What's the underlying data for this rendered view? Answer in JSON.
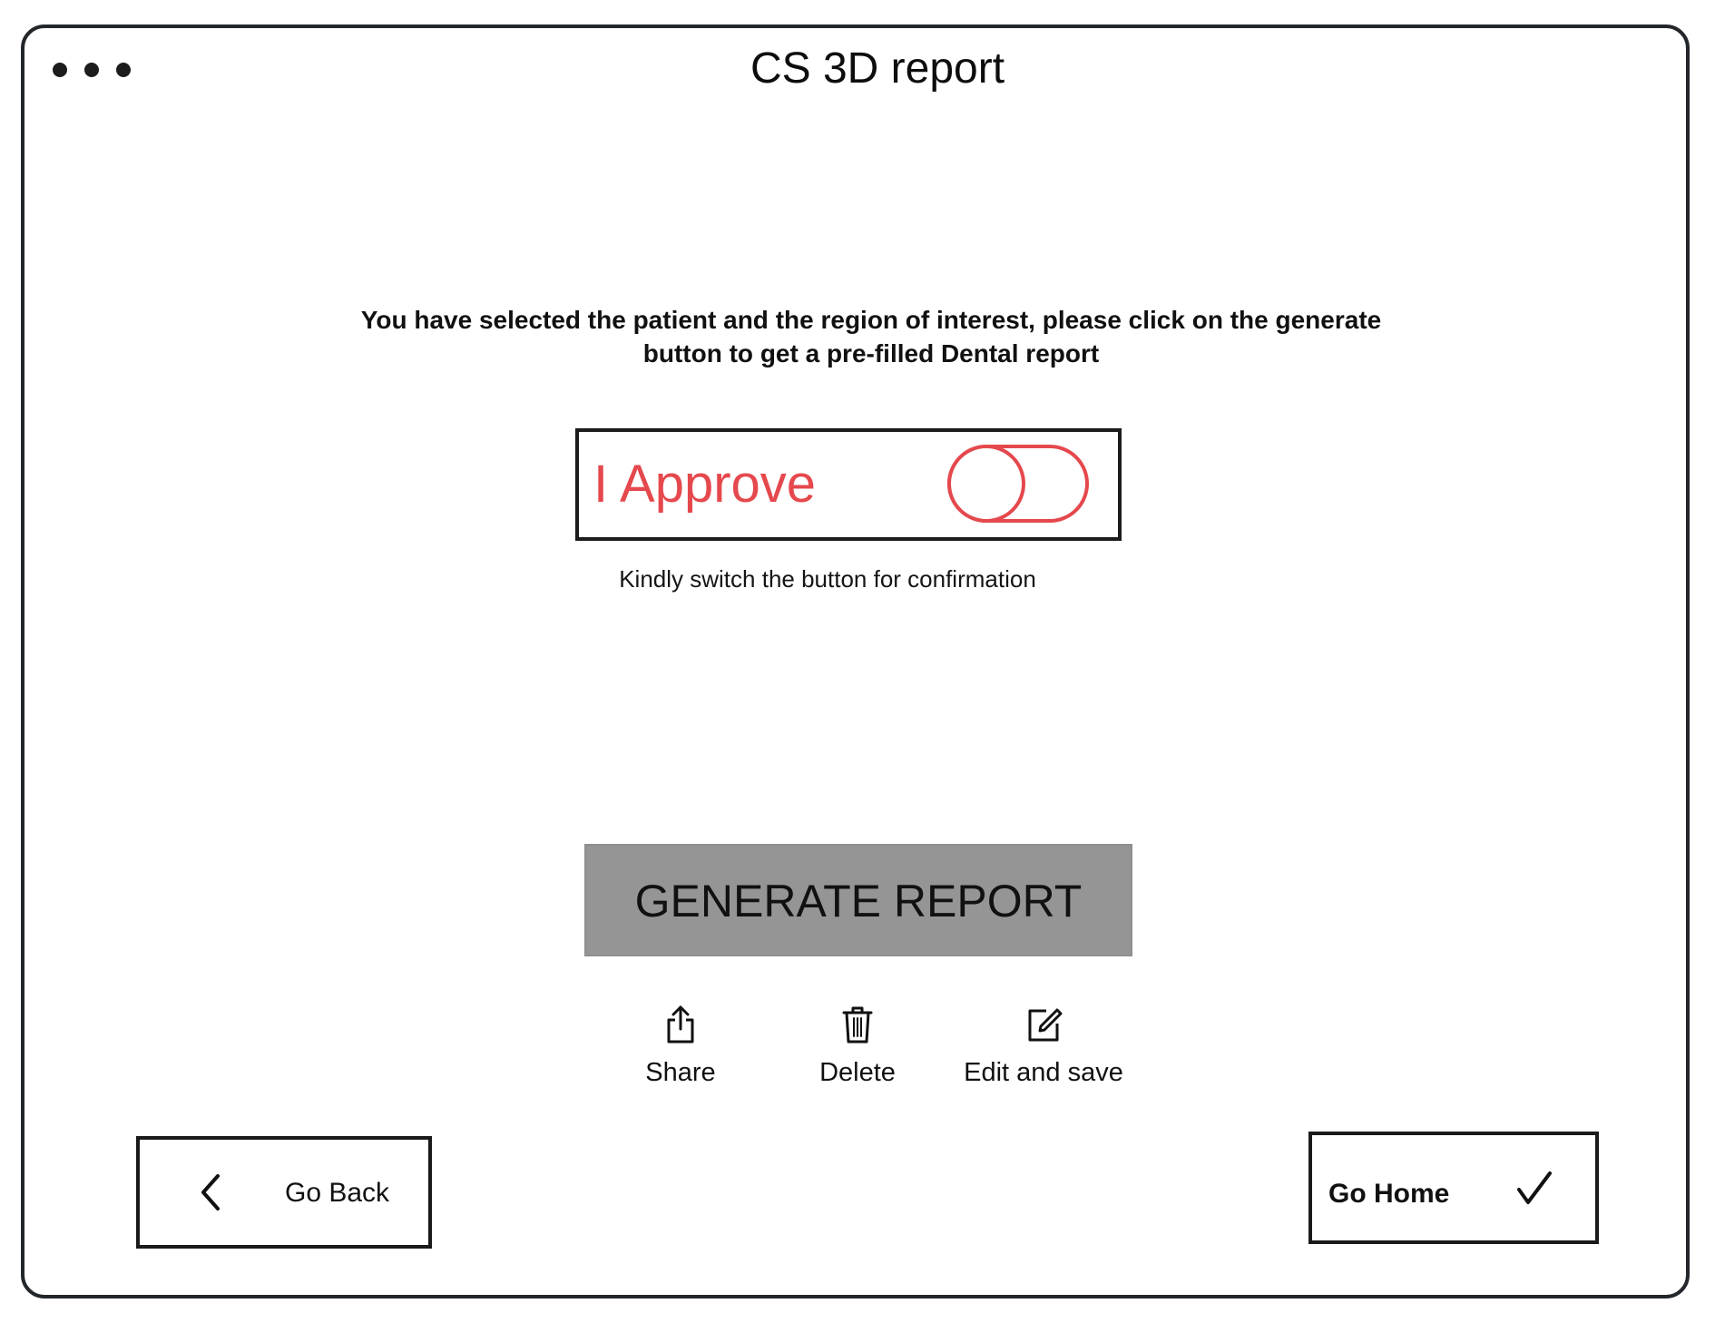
{
  "window": {
    "title": "CS 3D report",
    "menu_icon": "more-dots-icon"
  },
  "main": {
    "instructions": "You have selected the patient and the region of interest, please click on the generate button to get a pre-filled Dental report",
    "approval": {
      "label": "I Approve",
      "toggle_on": false,
      "hint": "Kindly switch the button for confirmation",
      "accent_color": "#e5484d"
    },
    "generate_button": {
      "label": "GENERATE REPORT",
      "background": "#959595"
    },
    "actions": [
      {
        "label": "Share",
        "icon": "share-icon"
      },
      {
        "label": "Delete",
        "icon": "trash-icon"
      },
      {
        "label": "Edit and save",
        "icon": "edit-icon"
      }
    ]
  },
  "footer": {
    "back_label": "Go Back",
    "back_icon": "chevron-left-icon",
    "home_label": "Go Home",
    "home_icon": "checkmark-icon"
  }
}
